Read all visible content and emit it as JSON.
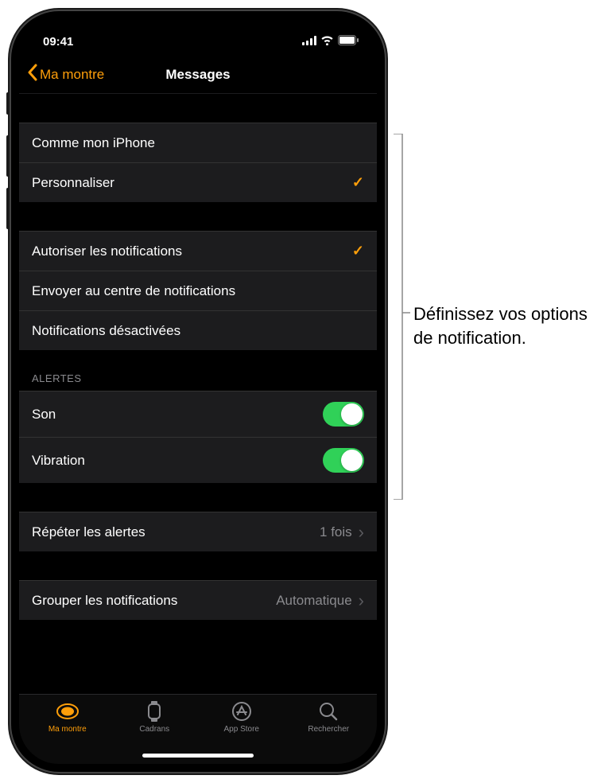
{
  "status": {
    "time": "09:41"
  },
  "nav": {
    "back": "Ma montre",
    "title": "Messages"
  },
  "group1": {
    "mirror": "Comme mon iPhone",
    "custom": "Personnaliser"
  },
  "group2": {
    "allow": "Autoriser les notifications",
    "send_center": "Envoyer au centre de notifications",
    "off": "Notifications désactivées"
  },
  "alerts": {
    "header": "Alertes",
    "sound": "Son",
    "haptic": "Vibration"
  },
  "repeat": {
    "label": "Répéter les alertes",
    "value": "1 fois"
  },
  "group": {
    "label": "Grouper les notifications",
    "value": "Automatique"
  },
  "tabs": {
    "watch": "Ma montre",
    "faces": "Cadrans",
    "store": "App Store",
    "search": "Rechercher"
  },
  "callout": "Définissez vos options de notification."
}
